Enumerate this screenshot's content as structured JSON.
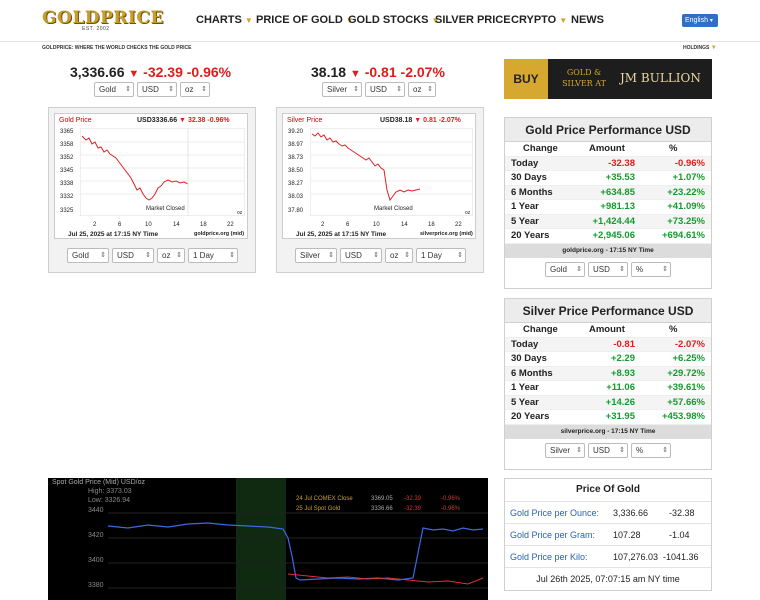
{
  "brand": {
    "logo": "GOLDPRICE",
    "est": "EST. 2002",
    "tagline": "GOLDPRICE: WHERE THE WORLD CHECKS THE GOLD PRICE"
  },
  "nav": {
    "items": [
      "CHARTS",
      "PRICE OF GOLD",
      "GOLD STOCKS",
      "SILVER PRICE",
      "CRYPTO",
      "NEWS"
    ],
    "language": "English",
    "holdings": "HOLDINGS"
  },
  "gold": {
    "price": "3,336.66",
    "change": "-32.39",
    "pct": "-0.96%",
    "selects": [
      "Gold",
      "USD",
      "oz"
    ],
    "chart": {
      "title": "Gold Price",
      "value": "USD3336.66",
      "change": "32.38",
      "pct": "-0.96%",
      "yticks": [
        "3365",
        "3358",
        "3352",
        "3345",
        "3338",
        "3332",
        "3325"
      ],
      "xticks": [
        "2",
        "6",
        "10",
        "14",
        "18",
        "22"
      ],
      "unit": "oz",
      "status": "Market Closed",
      "date": "Jul 25, 2025 at 17:15 NY Time",
      "source": "goldprice.org (mid)"
    },
    "chart_selects": [
      "Gold",
      "USD",
      "oz",
      "1 Day"
    ]
  },
  "silver": {
    "price": "38.18",
    "change": "-0.81",
    "pct": "-2.07%",
    "selects": [
      "Silver",
      "USD",
      "oz"
    ],
    "chart": {
      "title": "Silver Price",
      "value": "USD38.18",
      "change": "0.81",
      "pct": "-2.07%",
      "yticks": [
        "39.20",
        "38.97",
        "38.73",
        "38.50",
        "38.27",
        "38.03",
        "37.80"
      ],
      "xticks": [
        "2",
        "6",
        "10",
        "14",
        "18",
        "22"
      ],
      "unit": "oz",
      "status": "Market Closed",
      "date": "Jul 25, 2025 at 17:15 NY Time",
      "source": "silverprice.org (mid)"
    },
    "chart_selects": [
      "Silver",
      "USD",
      "oz",
      "1 Day"
    ]
  },
  "ad": {
    "buy": "BUY",
    "mid": "GOLD & SILVER AT",
    "brand": "JM BULLION"
  },
  "gold_perf": {
    "title": "Gold Price Performance USD",
    "headers": [
      "Change",
      "Amount",
      "%"
    ],
    "rows": [
      {
        "label": "Today",
        "amount": "-32.38",
        "pct": "-0.96%"
      },
      {
        "label": "30 Days",
        "amount": "+35.53",
        "pct": "+1.07%"
      },
      {
        "label": "6 Months",
        "amount": "+634.85",
        "pct": "+23.22%"
      },
      {
        "label": "1 Year",
        "amount": "+981.13",
        "pct": "+41.09%"
      },
      {
        "label": "5 Year",
        "amount": "+1,424.44",
        "pct": "+73.25%"
      },
      {
        "label": "20 Years",
        "amount": "+2,945.06",
        "pct": "+694.61%"
      }
    ],
    "footer": "goldprice.org - 17:15 NY Time",
    "selects": [
      "Gold",
      "USD",
      "%"
    ]
  },
  "silver_perf": {
    "title": "Silver Price Performance USD",
    "headers": [
      "Change",
      "Amount",
      "%"
    ],
    "rows": [
      {
        "label": "Today",
        "amount": "-0.81",
        "pct": "-2.07%"
      },
      {
        "label": "30 Days",
        "amount": "+2.29",
        "pct": "+6.25%"
      },
      {
        "label": "6 Months",
        "amount": "+8.93",
        "pct": "+29.72%"
      },
      {
        "label": "1 Year",
        "amount": "+11.06",
        "pct": "+39.61%"
      },
      {
        "label": "5 Year",
        "amount": "+14.26",
        "pct": "+57.66%"
      },
      {
        "label": "20 Years",
        "amount": "+31.95",
        "pct": "+453.98%"
      }
    ],
    "footer": "silverprice.org - 17:15 NY Time",
    "selects": [
      "Silver",
      "USD",
      "%"
    ]
  },
  "price_of_gold": {
    "title": "Price Of Gold",
    "rows": [
      {
        "label": "Gold Price per Ounce:",
        "value": "3,336.66",
        "change": "-32.38"
      },
      {
        "label": "Gold Price per Gram:",
        "value": "107.28",
        "change": "-1.04"
      },
      {
        "label": "Gold Price per Kilo:",
        "value": "107,276.03",
        "change": "-1041.36"
      }
    ],
    "date": "Jul 26th 2025, 07:07:15 am NY time"
  },
  "spot_chart": {
    "title": "Spot Gold Price (Mid) USD/oz",
    "high_label": "High:",
    "high": "3373.03",
    "low_label": "Low:",
    "low": "3326.94",
    "yticks": [
      "3440",
      "3420",
      "3400",
      "3380"
    ],
    "legend": [
      {
        "label": "24 Jul COMEX Close",
        "value": "3369.05",
        "change": "-32.39",
        "pct": "-0.96%"
      },
      {
        "label": "25 Jul Spot Gold",
        "value": "3336.66",
        "change": "-32.39",
        "pct": "-0.96%"
      }
    ]
  }
}
